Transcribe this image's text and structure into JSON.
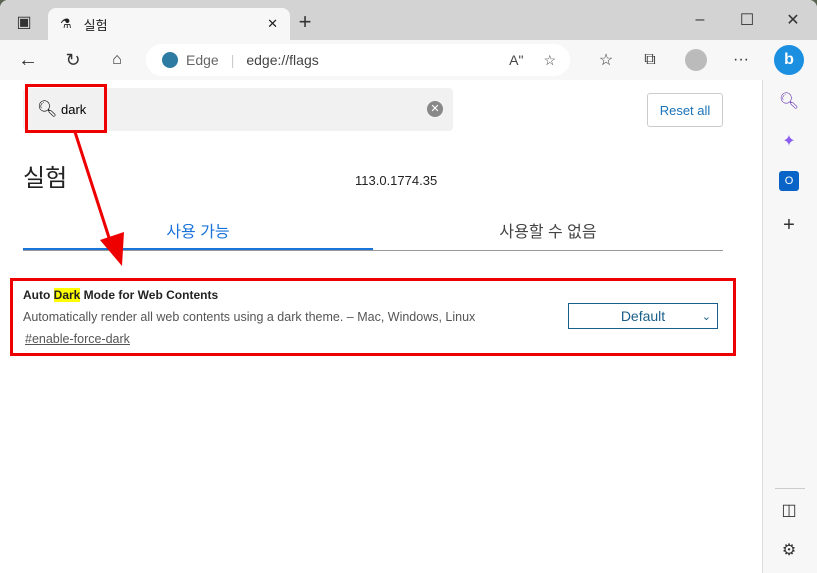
{
  "tab": {
    "title": "실험"
  },
  "address": {
    "site": "Edge",
    "url": "edge://flags"
  },
  "search": {
    "value": "dark"
  },
  "reset_label": "Reset all",
  "page_title": "실험",
  "version": "113.0.1774.35",
  "tabs": [
    {
      "label": "사용 가능"
    },
    {
      "label": "사용할 수 없음"
    }
  ],
  "flag": {
    "name_pre": "Auto ",
    "name_hl": "Dark",
    "name_post": " Mode for Web Contents",
    "description": "Automatically render all web contents using a dark theme. – Mac, Windows, Linux",
    "link": "#enable-force-dark",
    "selected": "Default"
  },
  "colors": {
    "accent": "#1a73d8",
    "annotation": "#e00000"
  }
}
